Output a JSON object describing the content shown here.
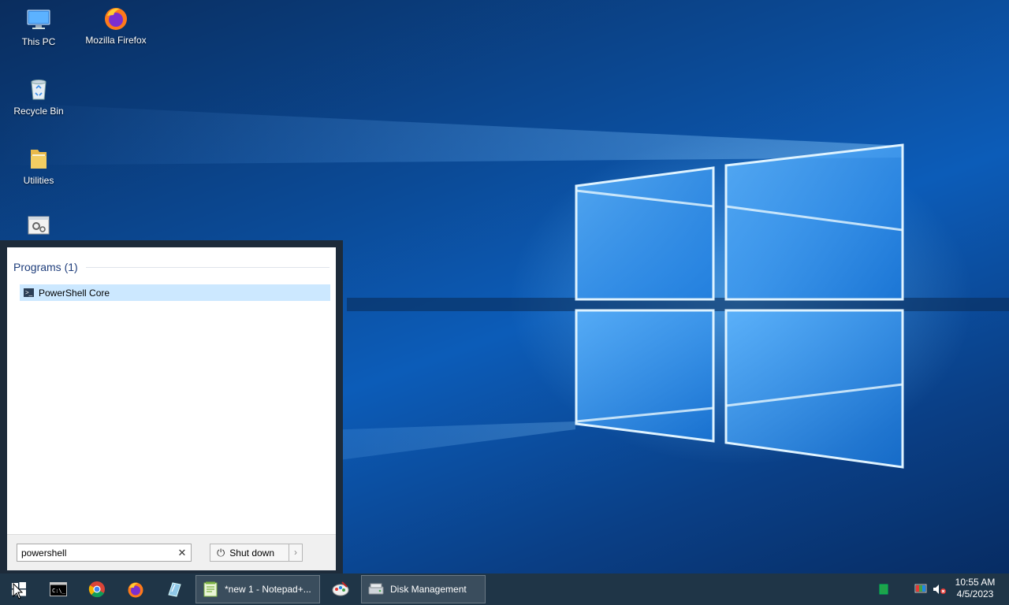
{
  "desktop": {
    "icons": [
      {
        "label": "This PC",
        "icon": "computer-icon"
      },
      {
        "label": "Mozilla Firefox",
        "icon": "firefox-icon"
      },
      {
        "label": "Recycle Bin",
        "icon": "recycle-bin-icon"
      },
      {
        "label": "Utilities",
        "icon": "folder-icon"
      },
      {
        "label": "",
        "icon": "settings-app-icon"
      }
    ]
  },
  "start_menu": {
    "programs_header": "Programs (1)",
    "results": [
      {
        "label": "PowerShell Core",
        "icon": "powershell-icon"
      }
    ],
    "search": {
      "value": "powershell"
    },
    "shutdown_label": "Shut down"
  },
  "taskbar": {
    "windows": [
      {
        "label": "*new 1 - Notepad+...",
        "icon": "notepadpp-icon"
      },
      {
        "label": "Disk Management",
        "icon": "disk-management-icon"
      }
    ],
    "clock": {
      "time": "10:55 AM",
      "date": "4/5/2023"
    }
  },
  "colors": {
    "taskbar": "#1f3547",
    "selection": "#cce8ff",
    "header_text": "#1e3d7b"
  }
}
